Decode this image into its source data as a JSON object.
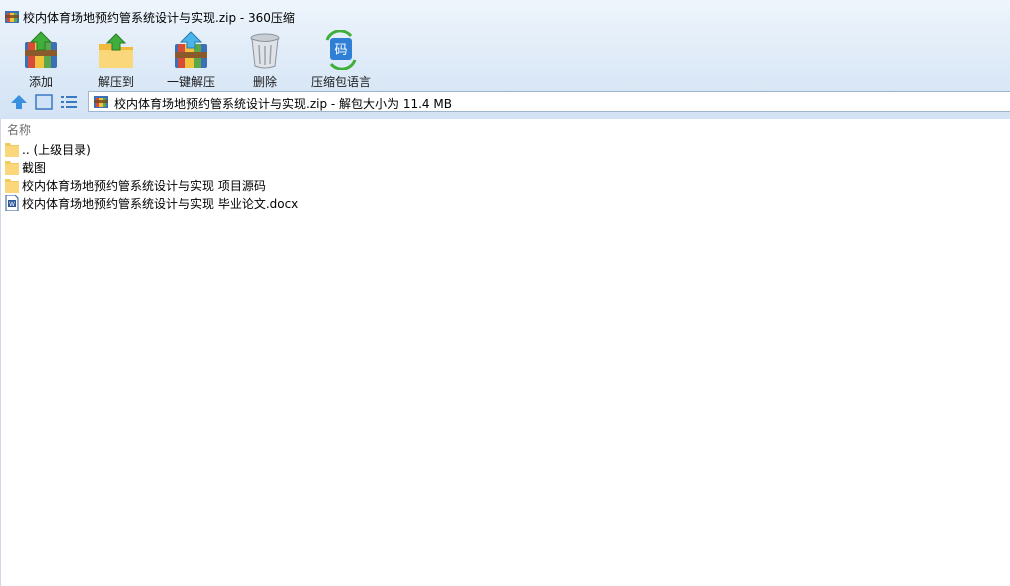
{
  "window": {
    "title": "校内体育场地预约管系统设计与实现.zip - 360压缩"
  },
  "toolbar": {
    "add": "添加",
    "extract_to": "解压到",
    "one_click_extract": "一键解压",
    "delete": "删除",
    "archive_language": "压缩包语言"
  },
  "address": {
    "text": "校内体育场地预约管系统设计与实现.zip - 解包大小为 11.4 MB"
  },
  "list": {
    "column_name": "名称",
    "items": [
      {
        "name": ".. (上级目录)",
        "icon": "folder-icon"
      },
      {
        "name": "截图",
        "icon": "folder-icon"
      },
      {
        "name": "校内体育场地预约管系统设计与实现 项目源码",
        "icon": "folder-icon"
      },
      {
        "name": "校内体育场地预约管系统设计与实现 毕业论文.docx",
        "icon": "word-doc-icon"
      }
    ]
  },
  "colors": {
    "toolbar_bg": "#dce9f7",
    "folder": "#f9d77a",
    "accent": "#2f7fd6"
  }
}
